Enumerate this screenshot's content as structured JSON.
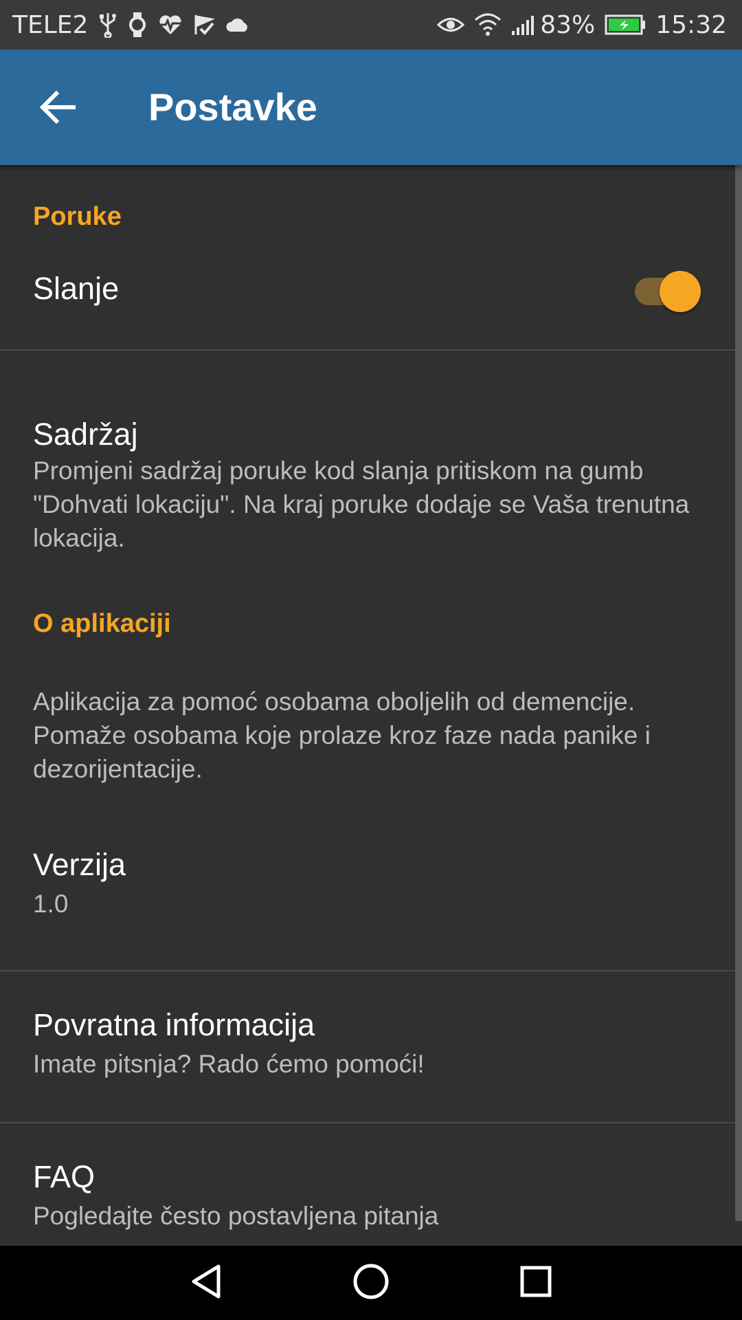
{
  "status_bar": {
    "carrier": "TELE2",
    "battery_percent": "83%",
    "time": "15:32",
    "icons_left": [
      "usb-icon",
      "watch-icon",
      "heart-rate-icon",
      "check-flag-icon",
      "cloud-icon"
    ],
    "icons_right": [
      "eye-icon",
      "wifi-icon",
      "signal-icon",
      "battery-charging-icon"
    ]
  },
  "app_bar": {
    "title": "Postavke",
    "back_icon": "arrow-back-icon",
    "color": "#2c6a9b"
  },
  "sections": {
    "poruke": {
      "header": "Poruke",
      "slanje": {
        "title": "Slanje",
        "enabled": true
      },
      "sadrzaj": {
        "title": "Sadržaj",
        "summary": "Promjeni sadržaj poruke kod slanja pritiskom na gumb \"Dohvati lokaciju\". Na kraj poruke dodaje se Vaša trenutna lokacija."
      }
    },
    "o_aplikaciji": {
      "header": "O aplikaciji",
      "description": "Aplikacija za pomoć osobama oboljelih od demencije. Pomaže osobama koje prolaze kroz faze nada panike i dezorijentacije.",
      "verzija": {
        "title": "Verzija",
        "value": "1.0"
      },
      "povratna": {
        "title": "Povratna informacija",
        "summary": "Imate pitsnja? Rado ćemo pomoći!"
      },
      "faq": {
        "title": "FAQ",
        "summary": "Pogledajte često postavljena pitanja"
      }
    }
  },
  "nav_bar": {
    "buttons": [
      "back-triangle-icon",
      "home-circle-icon",
      "recents-square-icon"
    ]
  },
  "colors": {
    "accent": "#f5a623",
    "background": "#303030",
    "divider": "#4a4a4a"
  }
}
